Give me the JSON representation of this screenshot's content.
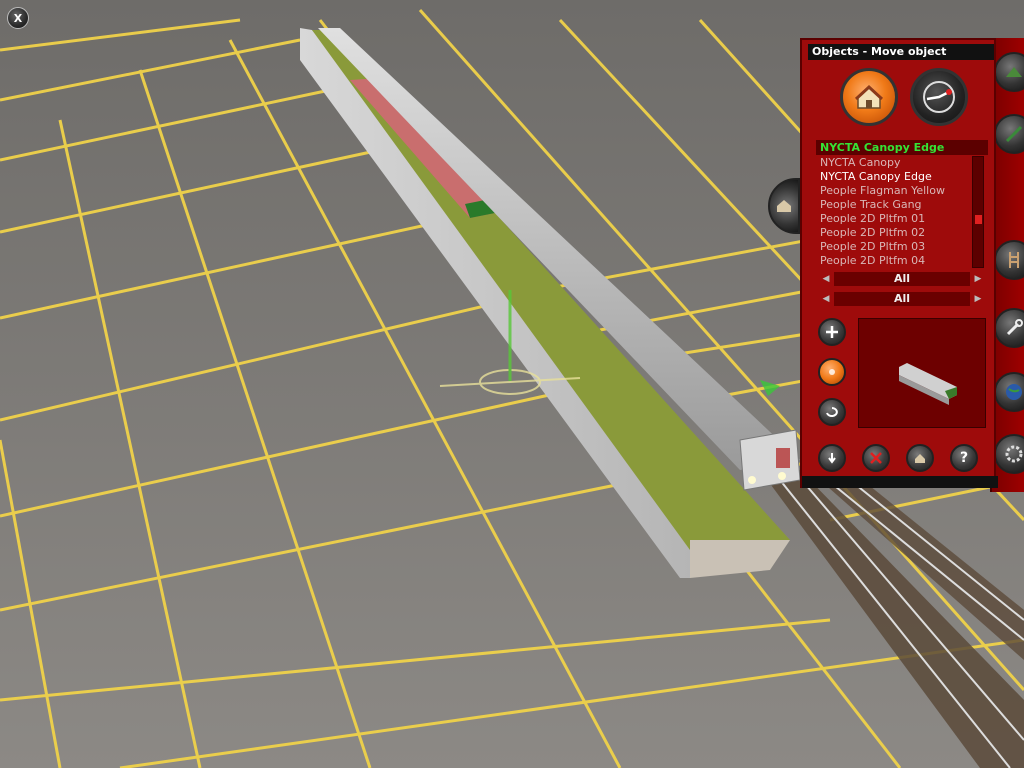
{
  "window": {
    "close_label": "X"
  },
  "panel": {
    "title": "Objects - Move object",
    "mode_buttons": [
      {
        "name": "objects",
        "icon": "house-icon"
      },
      {
        "name": "move",
        "icon": "move-gauge-icon"
      }
    ],
    "selected_object": "NYCTA Canopy Edge",
    "object_list": [
      "NYCTA Canopy",
      "NYCTA Canopy Edge",
      "People Flagman Yellow",
      "People Track Gang",
      "People 2D Pltfm 01",
      "People 2D Pltfm 02",
      "People 2D Pltfm 03",
      "People 2D Pltfm 04"
    ],
    "filters": [
      "All",
      "All"
    ],
    "tool_buttons": [
      "add-icon",
      "orange-target-icon",
      "rotate-icon"
    ],
    "bottom_buttons": [
      "pick-icon",
      "delete-icon",
      "object-settings-icon",
      "help-icon"
    ],
    "bottom_help": "?"
  },
  "colors": {
    "panel_red": "#9e0b0b",
    "selected_text_green": "#35e235",
    "grid_yellow": "#f0d24a",
    "ground_gray": "#7a7875"
  }
}
